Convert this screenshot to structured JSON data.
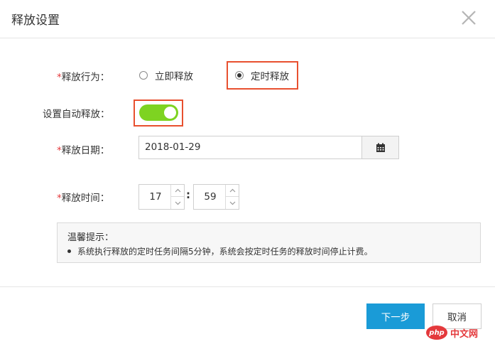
{
  "dialog": {
    "title": "释放设置",
    "close_icon": "close-icon"
  },
  "form": {
    "required_mark": "*",
    "release_action": {
      "label": "释放行为：",
      "options": [
        {
          "label": "立即释放",
          "checked": false
        },
        {
          "label": "定时释放",
          "checked": true
        }
      ]
    },
    "auto_release": {
      "label": "设置自动释放：",
      "enabled": true
    },
    "release_date": {
      "label": "释放日期：",
      "value": "2018-01-29",
      "calendar_icon": "calendar-icon"
    },
    "release_time": {
      "label": "释放时间：",
      "hour": "17",
      "minute": "59",
      "separator": ":"
    }
  },
  "notice": {
    "title": "温馨提示：",
    "items": [
      "系统执行释放的定时任务间隔5分钟，系统会按定时任务的释放时间停止计费。"
    ]
  },
  "footer": {
    "next_label": "下一步",
    "cancel_label": "取消"
  },
  "watermark": {
    "logo_text": "php",
    "text": "中文网"
  },
  "colors": {
    "primary": "#1a9bd7",
    "toggle_on": "#7ed321",
    "highlight": "#e8502f",
    "required": "#e4393c"
  }
}
